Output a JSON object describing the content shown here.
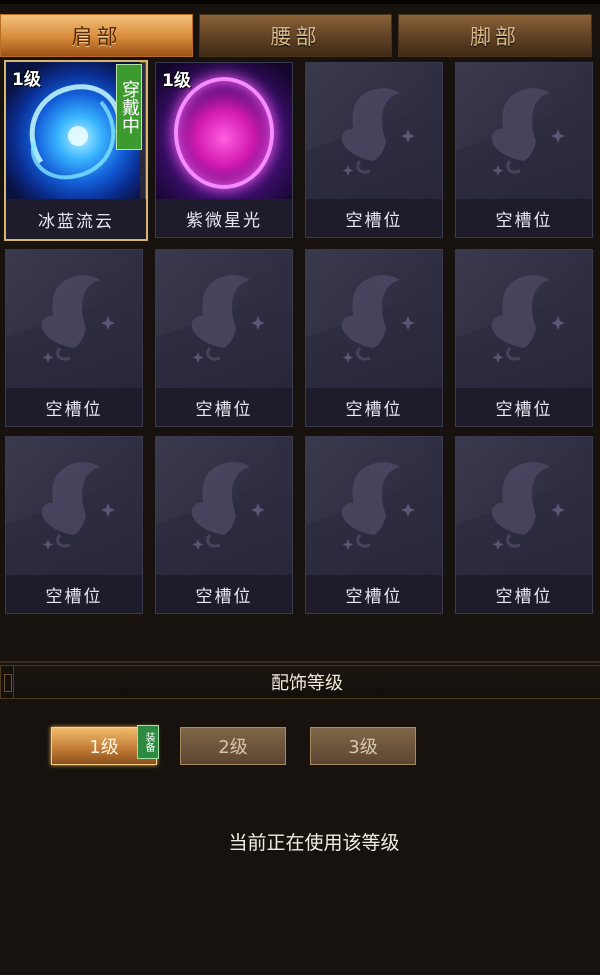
{
  "tabs": [
    {
      "label": "肩部",
      "active": true
    },
    {
      "label": "腰部",
      "active": false
    },
    {
      "label": "脚部",
      "active": false
    }
  ],
  "slots": [
    {
      "name": "冰蓝流云",
      "level": "1级",
      "badge": "穿戴中",
      "art": "blue-orb-icon"
    },
    {
      "name": "紫微星光",
      "level": "1级",
      "badge": "",
      "art": "purple-ring-icon"
    },
    {
      "name": "空槽位"
    },
    {
      "name": "空槽位"
    },
    {
      "name": "空槽位"
    },
    {
      "name": "空槽位"
    },
    {
      "name": "空槽位"
    },
    {
      "name": "空槽位"
    },
    {
      "name": "空槽位"
    },
    {
      "name": "空槽位"
    },
    {
      "name": "空槽位"
    },
    {
      "name": "空槽位"
    }
  ],
  "section": {
    "title": "配饰等级"
  },
  "levels": [
    {
      "label": "1级",
      "active": true
    },
    {
      "label": "2级",
      "active": false
    },
    {
      "label": "3级",
      "active": false
    }
  ],
  "equip_badge": "装备",
  "status": "当前正在使用该等级",
  "colors": {
    "accent": "#d88a3a",
    "wear_badge": "#3c9a2e",
    "slot_bg": "#2c2a3e",
    "page_bg": "#17120d"
  }
}
